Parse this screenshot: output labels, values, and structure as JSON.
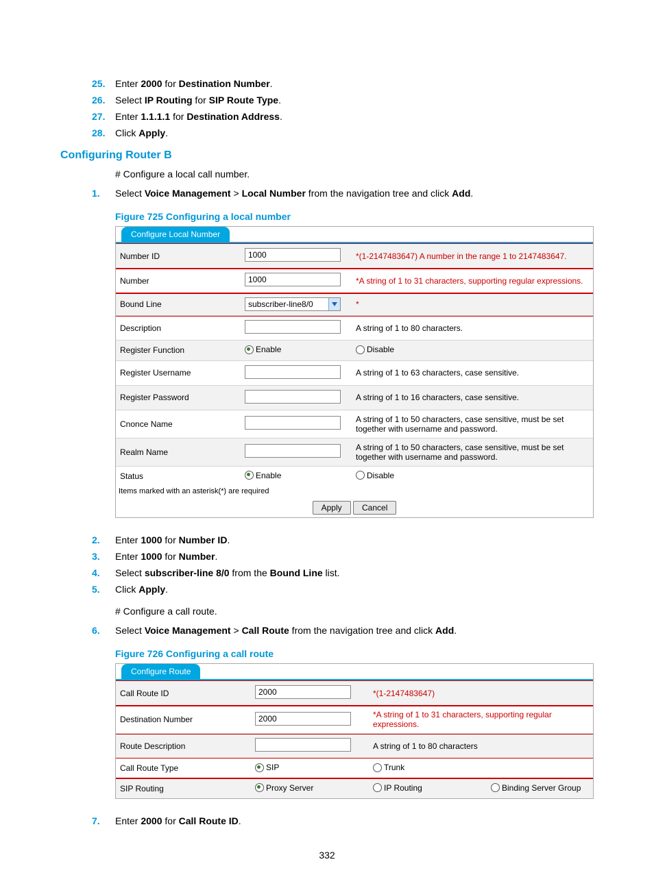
{
  "steps_top": {
    "s25": {
      "num": "25.",
      "pre": "Enter ",
      "b1": "2000",
      "mid": " for ",
      "b2": "Destination Number",
      "post": "."
    },
    "s26": {
      "num": "26.",
      "pre": "Select ",
      "b1": "IP Routing",
      "mid": " for ",
      "b2": "SIP Route Type",
      "post": "."
    },
    "s27": {
      "num": "27.",
      "pre": "Enter ",
      "b1": "1.1.1.1",
      "mid": " for ",
      "b2": "Destination Address",
      "post": "."
    },
    "s28": {
      "num": "28.",
      "pre": "Click ",
      "b1": "Apply",
      "post": "."
    }
  },
  "heading_router_b": "Configuring Router B",
  "para_cfg_local": "# Configure a local call number.",
  "step1": {
    "num": "1.",
    "pre": "Select ",
    "b1": "Voice Management",
    "gt": " > ",
    "b2": "Local Number",
    "mid": " from the navigation tree and click ",
    "b3": "Add",
    "post": "."
  },
  "fig725_caption": "Figure 725 Configuring a local number",
  "fig725": {
    "tab": "Configure Local Number",
    "rows": {
      "number_id": {
        "label": "Number ID",
        "value": "1000",
        "hint": "*(1-2147483647) A number in the range 1 to 2147483647."
      },
      "number": {
        "label": "Number",
        "value": "1000",
        "hint": "*A string of 1 to 31 characters, supporting regular expressions."
      },
      "bound_line": {
        "label": "Bound Line",
        "value": "subscriber-line8/0",
        "hint": "*"
      },
      "description": {
        "label": "Description",
        "value": "",
        "hint": "A string of 1 to 80 characters."
      },
      "reg_func": {
        "label": "Register Function",
        "enable": "Enable",
        "disable": "Disable"
      },
      "reg_user": {
        "label": "Register Username",
        "value": "",
        "hint": "A string of 1 to 63 characters, case sensitive."
      },
      "reg_pass": {
        "label": "Register Password",
        "value": "",
        "hint": "A string of 1 to 16 characters, case sensitive."
      },
      "cnonce": {
        "label": "Cnonce Name",
        "value": "",
        "hint": "A string of 1 to 50 characters, case sensitive, must be set together with username and password."
      },
      "realm": {
        "label": "Realm Name",
        "value": "",
        "hint": "A string of 1 to 50 characters, case sensitive, must be set together with username and password."
      },
      "status": {
        "label": "Status",
        "enable": "Enable",
        "disable": "Disable"
      }
    },
    "req_note": "Items marked with an asterisk(*) are required",
    "apply": "Apply",
    "cancel": "Cancel"
  },
  "steps_mid": {
    "s2": {
      "num": "2.",
      "pre": "Enter ",
      "b1": "1000",
      "mid": " for ",
      "b2": "Number ID",
      "post": "."
    },
    "s3": {
      "num": "3.",
      "pre": "Enter ",
      "b1": "1000",
      "mid": " for ",
      "b2": "Number",
      "post": "."
    },
    "s4": {
      "num": "4.",
      "pre": "Select ",
      "b1": "subscriber-line 8/0",
      "mid": " from the ",
      "b2": "Bound Line",
      "post": " list."
    },
    "s5": {
      "num": "5.",
      "pre": "Click ",
      "b1": "Apply",
      "post": "."
    }
  },
  "para_cfg_route": "# Configure a call route.",
  "step6": {
    "num": "6.",
    "pre": "Select ",
    "b1": "Voice Management",
    "gt": " > ",
    "b2": "Call Route",
    "mid": " from the navigation tree and click ",
    "b3": "Add",
    "post": "."
  },
  "fig726_caption": "Figure 726 Configuring a call route",
  "fig726": {
    "tab": "Configure Route",
    "rows": {
      "call_id": {
        "label": "Call Route ID",
        "value": "2000",
        "hint": "*(1-2147483647)"
      },
      "dest_num": {
        "label": "Destination Number",
        "value": "2000",
        "hint": "*A string of 1 to 31 characters, supporting regular expressions."
      },
      "route_desc": {
        "label": "Route Description",
        "value": "",
        "hint": "A string of 1 to 80 characters"
      },
      "route_type": {
        "label": "Call Route Type",
        "sip": "SIP",
        "trunk": "Trunk"
      },
      "sip_routing": {
        "label": "SIP Routing",
        "proxy": "Proxy Server",
        "ip": "IP Routing",
        "bind": "Binding Server Group"
      }
    }
  },
  "steps_bottom": {
    "s7": {
      "num": "7.",
      "pre": "Enter ",
      "b1": "2000",
      "mid": " for ",
      "b2": "Call Route ID",
      "post": "."
    }
  },
  "page_number": "332"
}
